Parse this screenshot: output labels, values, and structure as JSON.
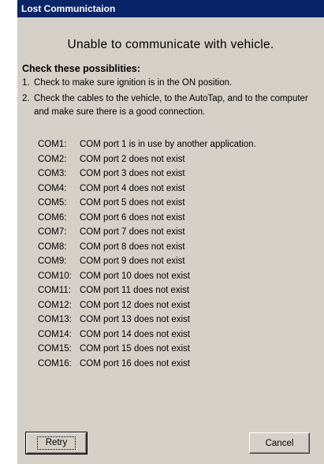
{
  "window": {
    "title": "Lost Communictaion"
  },
  "message": {
    "headline": "Unable to communicate with vehicle.",
    "subhead": "Check these possiblities:",
    "checks": [
      {
        "num": "1.",
        "text": "Check to make sure ignition is in the ON position."
      },
      {
        "num": "2.",
        "text": "Check the cables to the vehicle, to the AutoTap, and to the computer and make sure there is a good connection."
      }
    ]
  },
  "ports": [
    {
      "name": "COM1:",
      "status": "COM port 1 is in use by another application."
    },
    {
      "name": "COM2:",
      "status": "COM port 2 does not exist"
    },
    {
      "name": "COM3:",
      "status": "COM port 3 does not exist"
    },
    {
      "name": "COM4:",
      "status": "COM port 4 does not exist"
    },
    {
      "name": "COM5:",
      "status": "COM port 5 does not exist"
    },
    {
      "name": "COM6:",
      "status": "COM port 6 does not exist"
    },
    {
      "name": "COM7:",
      "status": "COM port 7 does not exist"
    },
    {
      "name": "COM8:",
      "status": "COM port 8 does not exist"
    },
    {
      "name": "COM9:",
      "status": "COM port 9 does not exist"
    },
    {
      "name": "COM10:",
      "status": "COM port 10 does not exist"
    },
    {
      "name": "COM11:",
      "status": "COM port 11 does not exist"
    },
    {
      "name": "COM12:",
      "status": "COM port 12 does not exist"
    },
    {
      "name": "COM13:",
      "status": "COM port 13 does not exist"
    },
    {
      "name": "COM14:",
      "status": "COM port 14 does not exist"
    },
    {
      "name": "COM15:",
      "status": "COM port 15 does not exist"
    },
    {
      "name": "COM16:",
      "status": "COM port 16 does not exist"
    }
  ],
  "buttons": {
    "retry_label": "Retry",
    "cancel_label": "Cancel"
  },
  "colors": {
    "title_bar": "#0a246a",
    "dialog_face": "#d4d0c8"
  }
}
